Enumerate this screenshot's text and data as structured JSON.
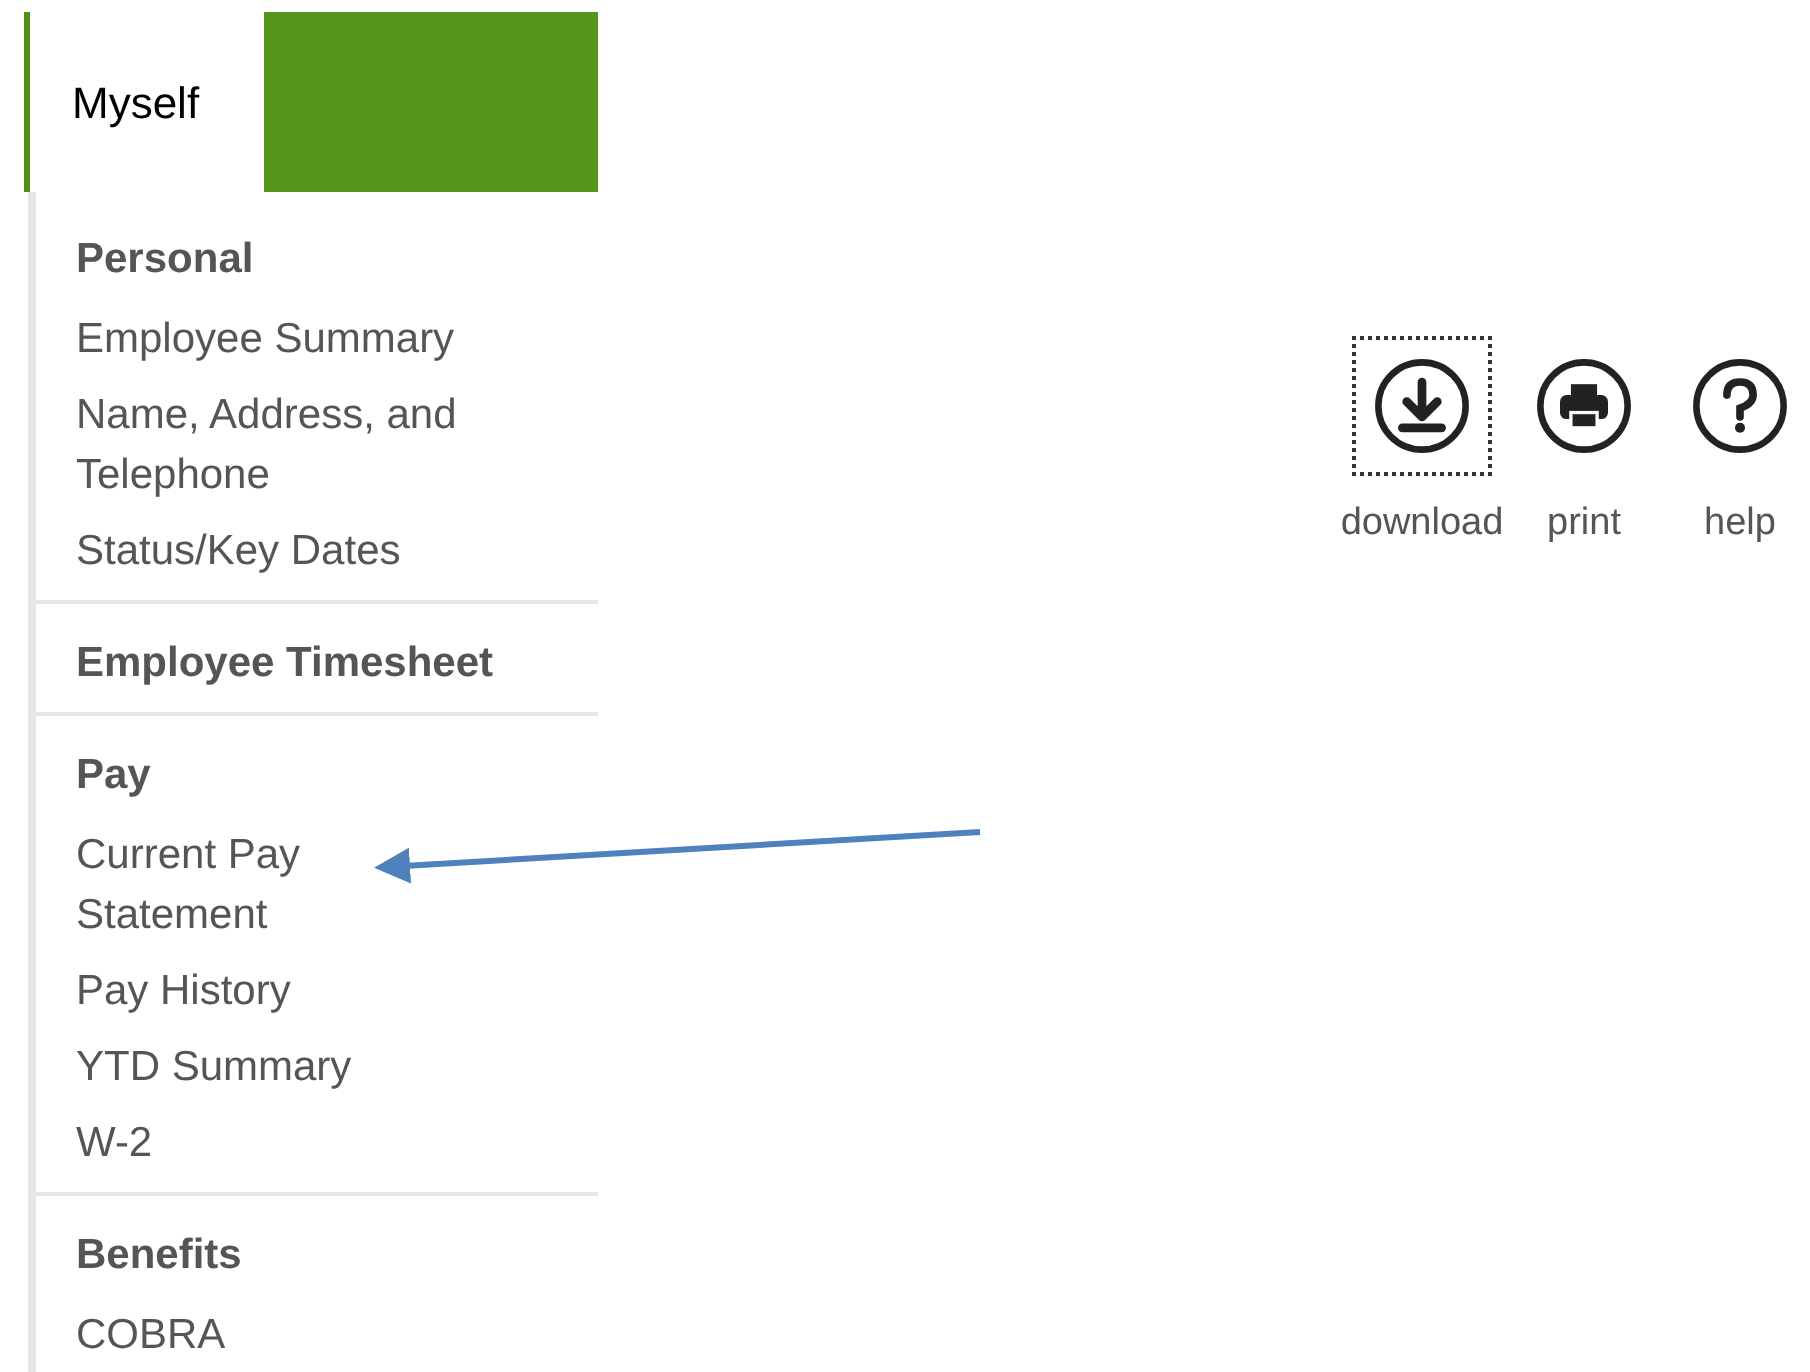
{
  "tabs": [
    {
      "kind": "label",
      "label": "Myself",
      "selected": true
    },
    {
      "kind": "blank",
      "selected": false
    }
  ],
  "sidebar": {
    "sections": [
      {
        "heading": "Personal",
        "items": [
          "Employee Summary",
          "Name, Address, and\nTelephone",
          "Status/Key Dates"
        ]
      },
      {
        "heading": "Employee Timesheet"
      },
      {
        "heading": "Pay",
        "items": [
          "Current Pay\nStatement",
          "Pay History",
          "YTD Summary",
          "W-2"
        ]
      },
      {
        "heading": "Benefits",
        "items": [
          "COBRA"
        ]
      }
    ]
  },
  "tools": [
    {
      "kind": "download",
      "label": "download",
      "focused": true
    },
    {
      "kind": "print",
      "label": "print",
      "focused": false
    },
    {
      "kind": "help",
      "label": "help",
      "focused": false
    }
  ]
}
